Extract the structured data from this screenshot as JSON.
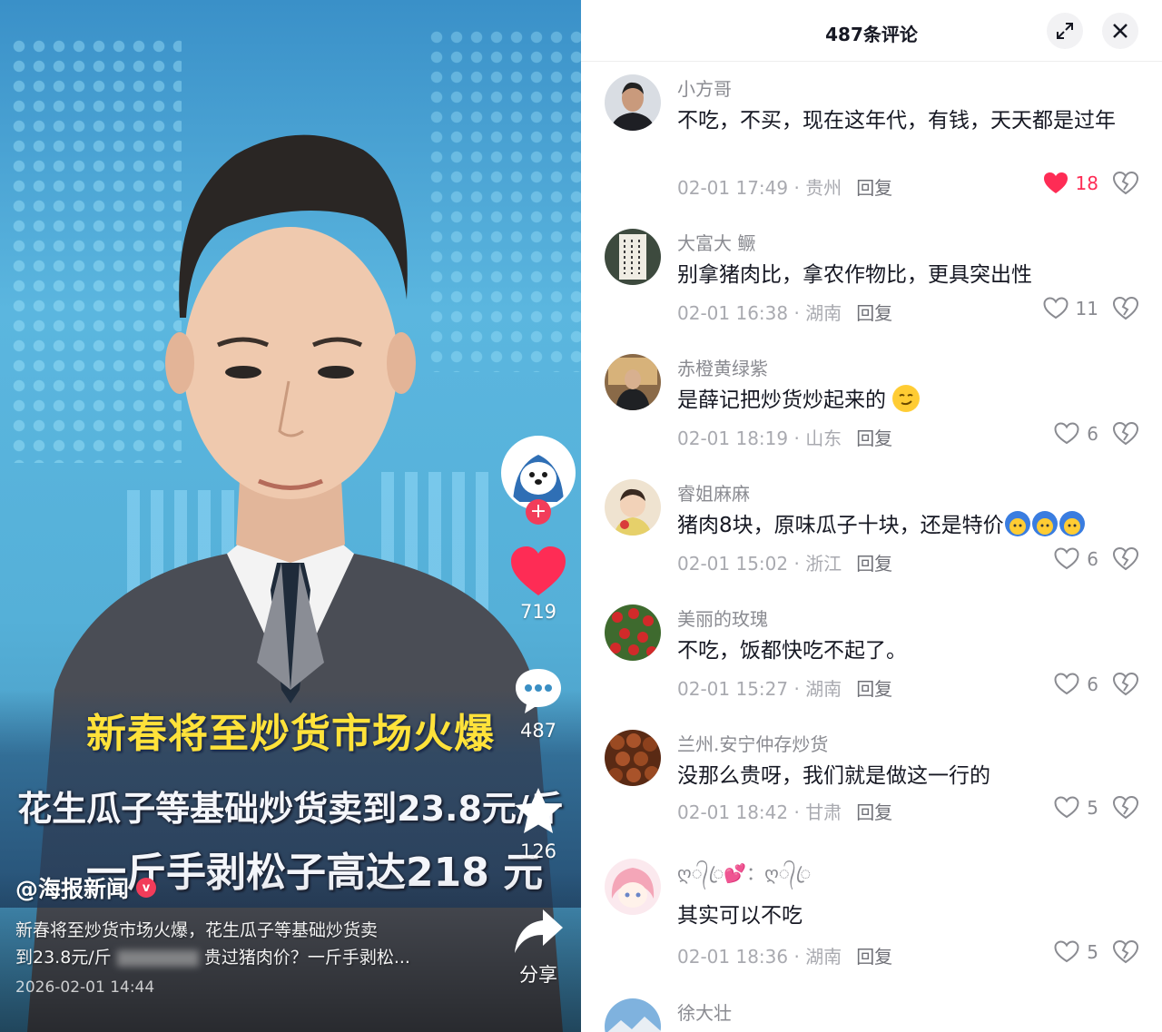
{
  "video": {
    "headline_line1": "新春将至炒货市场火爆",
    "headline_line2": "花生瓜子等基础炒货卖到23.8元/斤",
    "headline_line3": "一斤手剥松子高达218 元",
    "author": "@海报新闻",
    "verified_badge": "v",
    "description_part1": "新春将至炒货市场火爆，花生瓜子等基础炒货卖",
    "description_part2": "到23.8元/斤",
    "description_part3": "贵过猪肉价？一斤手剥松...",
    "date": "2026-02-01 14:44",
    "side_actions": {
      "follow_plus": "+",
      "likes": "719",
      "comments": "487",
      "favorites": "126",
      "share_label": "分享"
    },
    "colors": {
      "like_red": "#fe2c55",
      "headline_yellow": "#ffe23a"
    }
  },
  "comments_panel": {
    "title": "487条评论",
    "expand_icon": "expand-icon",
    "close_icon": "close-icon",
    "reply_label": "回复",
    "comments": [
      {
        "name": "小方哥",
        "text": "不吃，不买，现在这年代，有钱，天天都是过年",
        "time": "02-01 17:49",
        "location": "贵州",
        "likes": "18",
        "liked": true
      },
      {
        "name": "大富大 鳜",
        "text": "别拿猪肉比，拿农作物比，更具突出性",
        "time": "02-01 16:38",
        "location": "湖南",
        "likes": "11",
        "liked": false
      },
      {
        "name": "赤橙黄绿紫",
        "text": "是薛记把炒货炒起来的",
        "time": "02-01 18:19",
        "location": "山东",
        "likes": "6",
        "liked": false
      },
      {
        "name": "睿姐麻麻",
        "text": "猪肉8块，原味瓜子十块，还是特价",
        "time": "02-01 15:02",
        "location": "浙江",
        "likes": "6",
        "liked": false
      },
      {
        "name": "美丽的玫瑰",
        "text": "不吃，饭都快吃不起了。",
        "time": "02-01 15:27",
        "location": "湖南",
        "likes": "6",
        "liked": false
      },
      {
        "name": "兰州.安宁仲存炒货",
        "text": "没那么贵呀，我们就是做这一行的",
        "time": "02-01 18:42",
        "location": "甘肃",
        "likes": "5",
        "liked": false
      },
      {
        "name": "ღ᭄ꦿ💕：ღ᭄ꦿ",
        "text": "其实可以不吃",
        "time": "02-01 18:36",
        "location": "湖南",
        "likes": "5",
        "liked": false
      },
      {
        "name": "徐大壮",
        "text": "",
        "time": "",
        "location": "",
        "likes": "",
        "liked": false
      }
    ]
  }
}
